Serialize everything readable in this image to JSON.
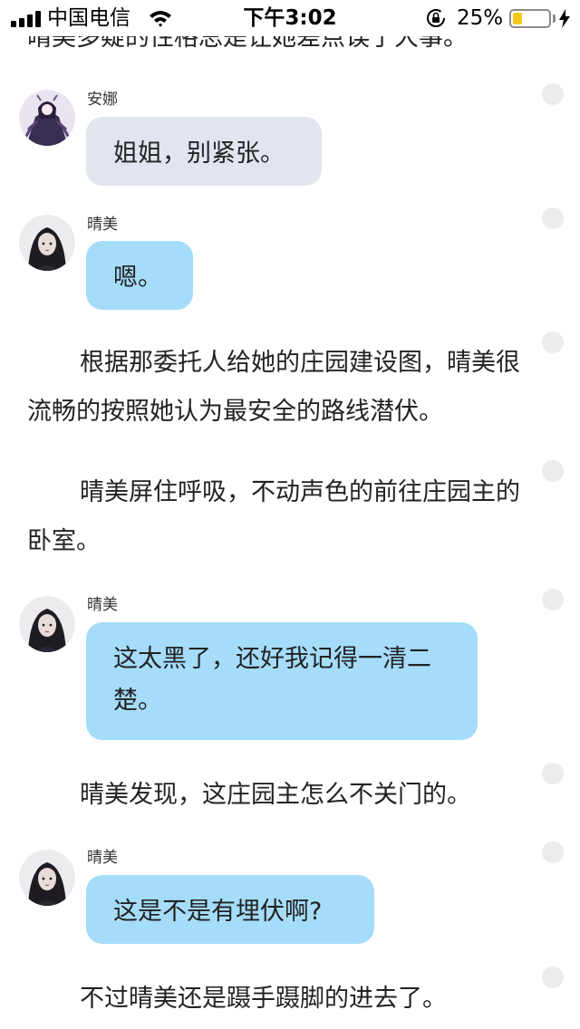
{
  "status_bar": {
    "carrier": "中国电信",
    "time": "下午3:02",
    "battery_percent": "25%",
    "battery_level": 0.25,
    "icons": [
      "signal-icon",
      "wifi-icon",
      "orientation-lock-icon",
      "battery-icon",
      "charging-icon"
    ]
  },
  "chat": {
    "cut_top_text": "晴美多疑的性格总是让她差点误了大事。",
    "anna": {
      "name": "安娜",
      "message": "姐姐，别紧张。"
    },
    "qingmei_1": {
      "name": "晴美",
      "message": "嗯。"
    },
    "narration_1": "根据那委托人给她的庄园建设图，晴美很流畅的按照她认为最安全的路线潜伏。",
    "narration_2": "晴美屏住呼吸，不动声色的前往庄园主的卧室。",
    "qingmei_2": {
      "name": "晴美",
      "message": "这太黑了，还好我记得一清二楚。"
    },
    "narration_3": "晴美发现，这庄园主怎么不关门的。",
    "qingmei_3": {
      "name": "晴美",
      "message": "这是不是有埋伏啊?"
    },
    "narration_4": "不过晴美还是蹑手蹑脚的进去了。"
  },
  "colors": {
    "bubble_gray": "#e0e5ee",
    "bubble_blue": "#a5dcfa",
    "battery_yellow": "#f5c71a",
    "dot_gray": "#ececec"
  }
}
